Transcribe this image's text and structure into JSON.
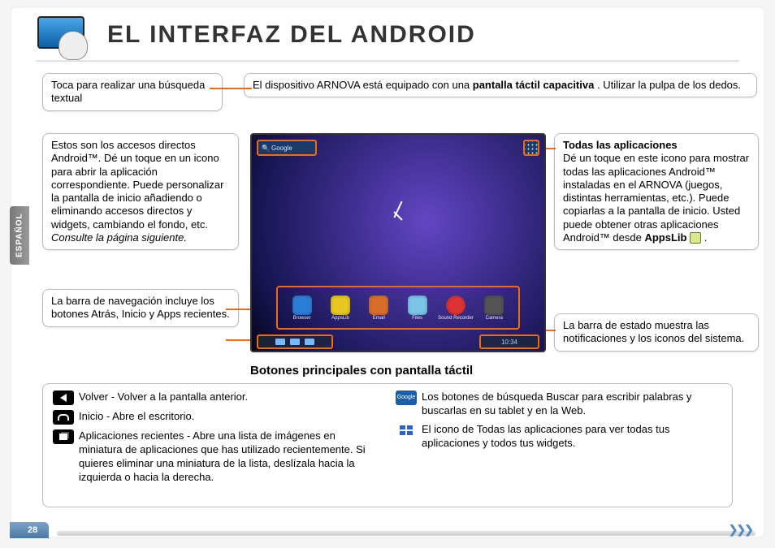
{
  "lang_tab": "ESPAÑOL",
  "page_number": "28",
  "header": {
    "title": "EL INTERFAZ DEL ANDROID"
  },
  "intro": {
    "text_before_bold": "El dispositivo ARNOVA está equipado con una ",
    "bold": "pantalla táctil capacitiva",
    "text_after_bold": ". Utilizar la pulpa de los dedos."
  },
  "callouts": {
    "search": "Toca para realizar una búsqueda textual",
    "shortcuts_main": "Estos son los accesos directos Android™. Dé un toque en un icono para abrir la aplicación correspondiente. Puede personalizar la pantalla de inicio añadiendo o eliminando accesos directos y widgets, cambiando el fondo, etc. ",
    "shortcuts_italic": "Consulte la página siguiente.",
    "nav": "La barra de navegación incluye los botones Atrás, Inicio y Apps recientes.",
    "allapps_title": "Todas las aplicaciones",
    "allapps_body": "Dé un toque en este icono para mostrar todas las aplicaciones Android™ instaladas en el ARNOVA (juegos, distintas herramientas, etc.). Puede copiarlas a la pantalla de inicio. Usted puede obtener otras aplicaciones Android™ desde ",
    "allapps_appslib": "AppsLib",
    "status": "La barra de estado muestra las notificaciones y los iconos del sistema."
  },
  "device": {
    "search_label": "Google",
    "dock": [
      "Browser",
      "AppsLib",
      "Email",
      "Files",
      "Sound Recorder",
      "Camera"
    ],
    "time": "10:34"
  },
  "bottom": {
    "section_title": "Botones principales con pantalla táctil",
    "left": [
      {
        "icon": "back",
        "text": "Volver - Volver a la pantalla anterior."
      },
      {
        "icon": "home",
        "text": "Inicio - Abre el escritorio."
      },
      {
        "icon": "recent",
        "text": "Aplicaciones recientes - Abre una lista de imágenes en miniatura de aplicaciones que has utilizado recientemente. Si quieres eliminar una miniatura de la lista, deslízala hacia la izquierda o hacia la derecha."
      }
    ],
    "right": [
      {
        "icon": "search",
        "text": "Los botones de búsqueda Buscar para escribir palabras y buscarlas en su tablet y en la Web."
      },
      {
        "icon": "grid",
        "text": "El icono de Todas las aplicaciones para ver todas tus aplicaciones y todos tus widgets."
      }
    ]
  }
}
